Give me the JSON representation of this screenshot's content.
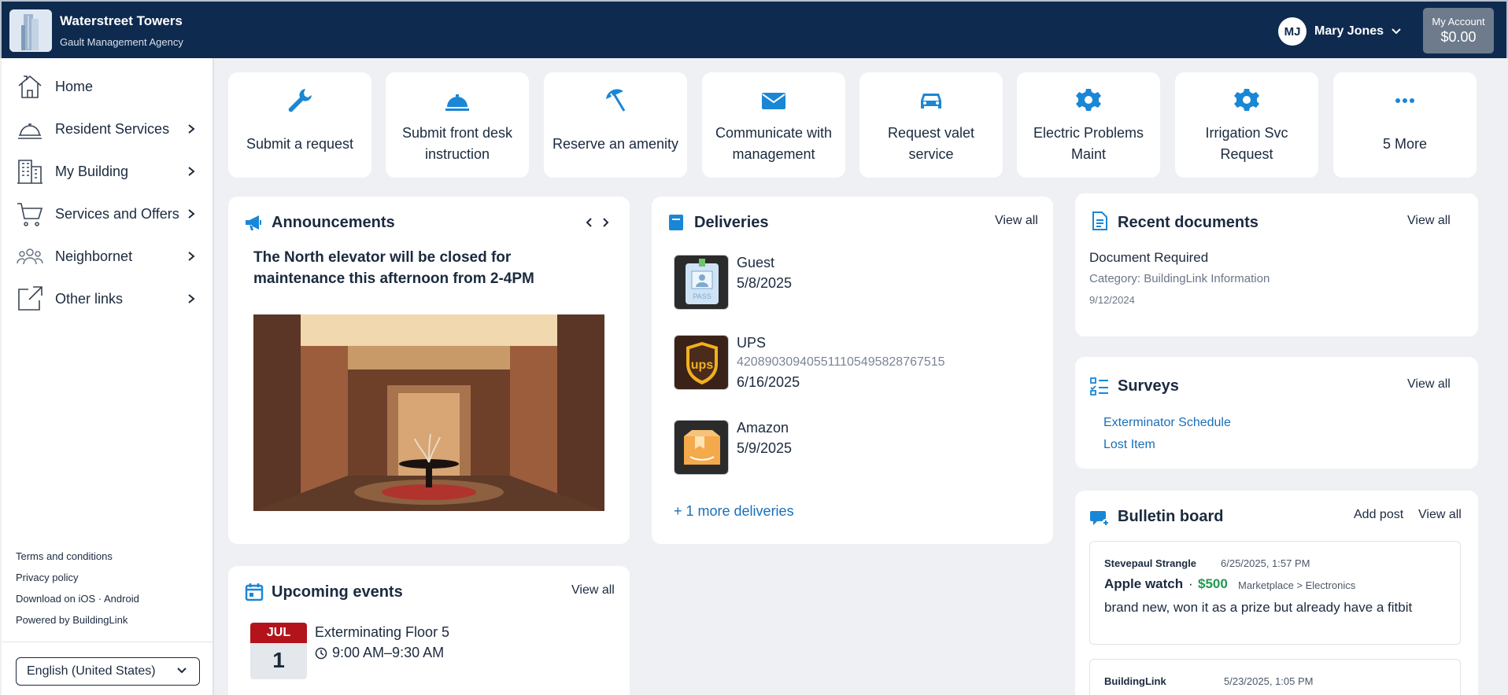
{
  "header": {
    "building_name": "Waterstreet Towers",
    "agency": "Gault Management Agency",
    "user_initials": "MJ",
    "user_name": "Mary Jones",
    "account_label": "My Account",
    "account_balance": "$0.00"
  },
  "sidebar": {
    "items": [
      {
        "label": "Home",
        "icon": "house-icon"
      },
      {
        "label": "Resident Services",
        "icon": "bell-icon"
      },
      {
        "label": "My Building",
        "icon": "building-icon"
      },
      {
        "label": "Services and Offers",
        "icon": "cart-icon"
      },
      {
        "label": "Neighbornet",
        "icon": "people-icon"
      },
      {
        "label": "Other links",
        "icon": "external-link-icon"
      }
    ],
    "footer_links": [
      "Terms and conditions",
      "Privacy policy",
      "Download on iOS · Android",
      "Powered by BuildingLink"
    ],
    "language": "English (United States)"
  },
  "quick_actions": [
    {
      "label": "Submit a request",
      "icon": "wrench-icon"
    },
    {
      "label": "Submit front desk instruction",
      "icon": "service-bell-icon"
    },
    {
      "label": "Reserve an amenity",
      "icon": "umbrella-icon"
    },
    {
      "label": "Communicate with management",
      "icon": "envelope-icon"
    },
    {
      "label": "Request valet service",
      "icon": "car-icon"
    },
    {
      "label": "Electric Problems Maint",
      "icon": "gear-icon"
    },
    {
      "label": "Irrigation Svc Request",
      "icon": "gear-icon"
    },
    {
      "label": "5 More",
      "icon": "ellipsis-icon"
    }
  ],
  "announcements": {
    "title": "Announcements",
    "text": "The North elevator will be closed for maintenance this afternoon from 2-4PM"
  },
  "deliveries": {
    "title": "Deliveries",
    "view_all": "View all",
    "items": [
      {
        "name": "Guest",
        "tracking": "",
        "date": "5/8/2025"
      },
      {
        "name": "UPS",
        "tracking": "42089030940551110549582876751​5",
        "date": "6/16/2025"
      },
      {
        "name": "Amazon",
        "tracking": "",
        "date": "5/9/2025"
      }
    ],
    "more": "+ 1 more deliveries"
  },
  "documents": {
    "title": "Recent documents",
    "view_all": "View all",
    "doc_title": "Document Required",
    "doc_category": "Category: BuildingLink Information",
    "doc_date": "9/12/2024"
  },
  "surveys": {
    "title": "Surveys",
    "view_all": "View all",
    "items": [
      "Exterminator Schedule",
      "Lost Item"
    ]
  },
  "bulletin": {
    "title": "Bulletin board",
    "add_post": "Add post",
    "view_all": "View all",
    "posts": [
      {
        "author": "Stevepaul Strangle",
        "date": "6/25/2025, 1:57 PM",
        "title": "Apple watch",
        "price": "$500",
        "category": "Marketplace > Electronics",
        "body": "brand new, won it as a prize but already have a fitbit"
      },
      {
        "author": "BuildingLink",
        "date": "5/23/2025, 1:05 PM"
      }
    ]
  },
  "events": {
    "title": "Upcoming events",
    "view_all": "View all",
    "month": "JUL",
    "day": "1",
    "event_name": "Exterminating Floor 5",
    "event_time": "9:00 AM–9:30 AM"
  },
  "colors": {
    "header": "#0e2a4f",
    "accent": "#1a86d6",
    "link": "#1a6fb8",
    "price": "#1f9a4f",
    "calendar_red": "#b3141c"
  }
}
